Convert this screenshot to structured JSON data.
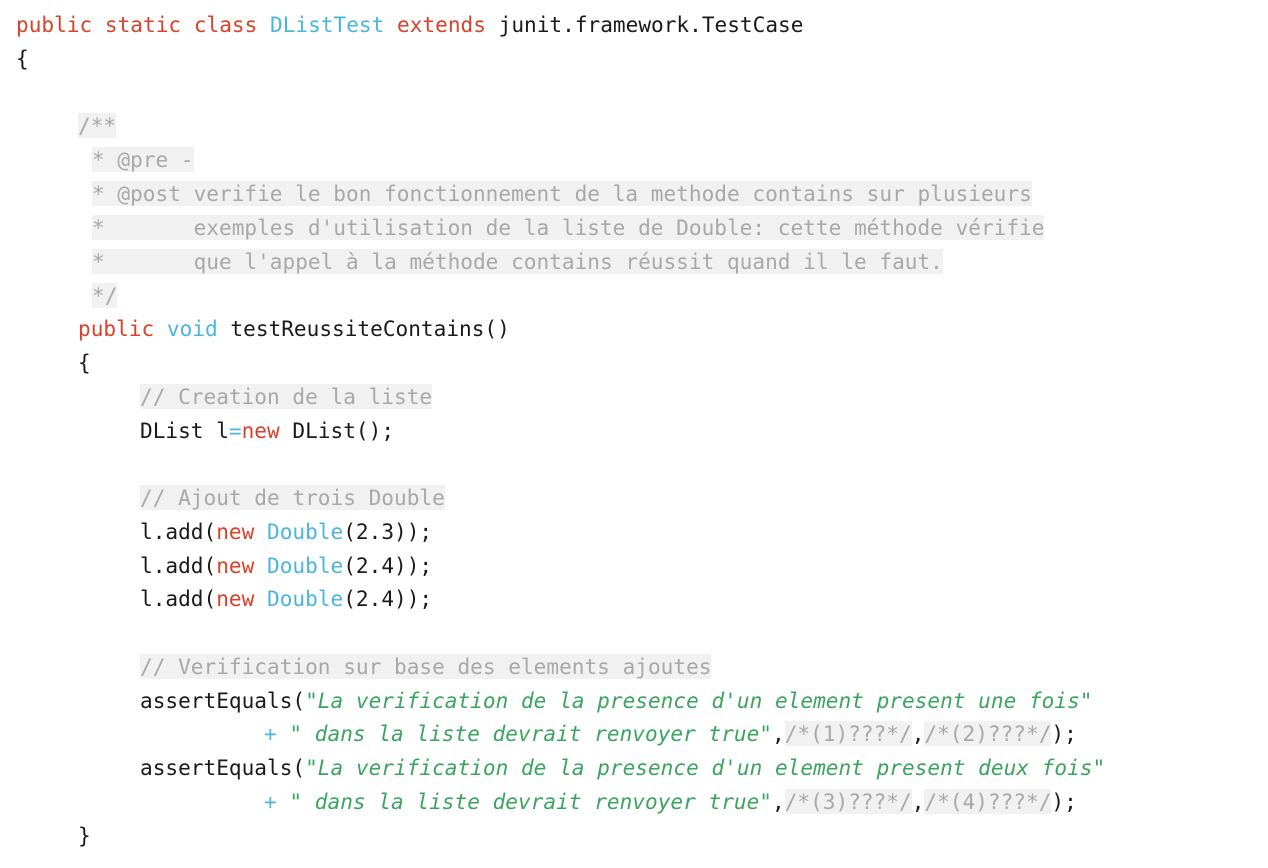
{
  "code": {
    "l1": {
      "kw1": "public",
      "kw2": "static",
      "kw3": "class",
      "cls": "DListTest",
      "kw4": "extends",
      "base": "junit.framework.TestCase"
    },
    "l2": "{",
    "doc": {
      "c1": "/**",
      "c2": "* @pre -",
      "c3": "* @post verifie le bon fonctionnement de la methode contains sur plusieurs",
      "c4": "*       exemples d'utilisation de la liste de Double: cette méthode vérifie",
      "c5": "*       que l'appel à la méthode contains réussit quand il le faut.",
      "c6": "*/"
    },
    "method": {
      "kw": "public",
      "ret": "void",
      "name": "testReussiteContains()"
    },
    "open_brace": "{",
    "cmt_create": "// Creation de la liste",
    "decl": {
      "a": "DList l",
      "eq": "=",
      "kw": "new",
      "b": " DList();"
    },
    "cmt_add": "// Ajout de trois Double",
    "adds": [
      {
        "call": "l.add(",
        "kw": "new",
        "ty": "Double",
        "arg": "(2.3));"
      },
      {
        "call": "l.add(",
        "kw": "new",
        "ty": "Double",
        "arg": "(2.4));"
      },
      {
        "call": "l.add(",
        "kw": "new",
        "ty": "Double",
        "arg": "(2.4));"
      }
    ],
    "cmt_verif": "// Verification sur base des elements ajoutes",
    "asserts": [
      {
        "call": "assertEquals(",
        "str1": "\"La verification de la presence d'un element present une fois\"",
        "plus": "+",
        "str2": "\" dans la liste devrait renvoyer true\"",
        "ph1": "/*(1)???*/",
        "ph2": "/*(2)???*/"
      },
      {
        "call": "assertEquals(",
        "str1": "\"La verification de la presence d'un element present deux fois\"",
        "plus": "+",
        "str2": "\" dans la liste devrait renvoyer true\"",
        "ph1": "/*(3)???*/",
        "ph2": "/*(4)???*/"
      }
    ],
    "close_brace": "}",
    "comma": ",",
    "close_call": ");"
  }
}
